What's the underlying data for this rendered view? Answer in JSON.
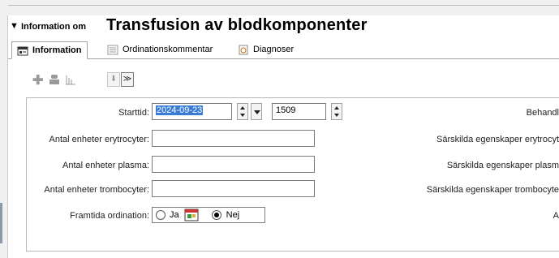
{
  "header": {
    "prefix": "Information om",
    "title": "Transfusion av blodkomponenter"
  },
  "tabs": [
    {
      "label": "Information",
      "active": true,
      "icon": "info-card-icon"
    },
    {
      "label": "Ordinationskommentar",
      "active": false,
      "icon": "notes-icon"
    },
    {
      "label": "Diagnoser",
      "active": false,
      "icon": "diagnosis-icon"
    }
  ],
  "toolbar": {
    "icons": [
      "add-icon",
      "stamp-icon",
      "chart-icon",
      "move-down-icon",
      "expand-icon"
    ]
  },
  "form": {
    "starttid_label": "Starttid:",
    "starttid_date": "2024-09-23",
    "starttid_time": "1509",
    "erytrocyter_label": "Antal enheter erytrocyter:",
    "erytrocyter_value": "",
    "plasma_label": "Antal enheter plasma:",
    "plasma_value": "",
    "trombocyter_label": "Antal enheter trombocyter:",
    "trombocyter_value": "",
    "framtida_label": "Framtida ordination:",
    "framtida_ja": "Ja",
    "framtida_nej": "Nej",
    "framtida_selected": "Nej"
  },
  "right_labels": {
    "behandl": "Behandl",
    "erytrocyt": "Särskilda egenskaper erytrocyt",
    "plasm": "Särskilda egenskaper plasm",
    "trombocyt": "Särskilda egenskaper trombocyte",
    "a": "A"
  },
  "colors": {
    "selection": "#3a7bd5",
    "panel_bg": "#ffffff",
    "window_bg": "#f0f0f0"
  }
}
